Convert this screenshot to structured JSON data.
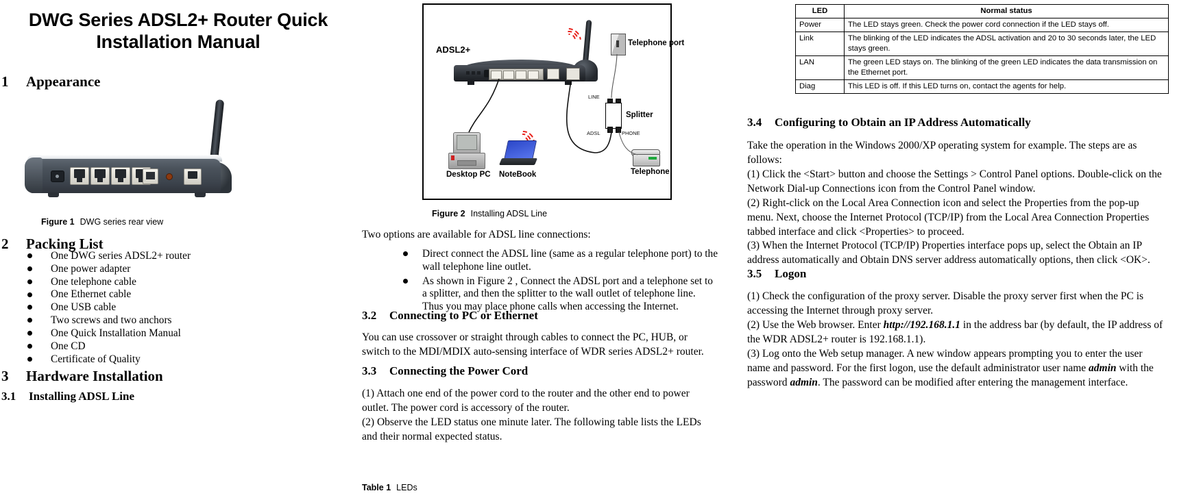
{
  "document": {
    "title": "DWG Series ADSL2+ Router Quick Installation Manual"
  },
  "left_column": {
    "section1": {
      "number": "1",
      "heading": "Appearance"
    },
    "figure1": {
      "label": "Figure 1",
      "caption": "DWG series rear view",
      "icon": "router-rear-view-photo"
    },
    "section2": {
      "number": "2",
      "heading": "Packing List"
    },
    "packing_list": [
      "One DWG  series ADSL2+ router",
      "One power adapter",
      "One telephone cable",
      "One Ethernet cable",
      "One USB cable",
      "Two screws and two anchors",
      "One Quick Installation Manual",
      "One CD",
      "Certificate of Quality"
    ],
    "section3": {
      "number": "3",
      "heading": "Hardware Installation"
    },
    "section3_1": {
      "number": "3.1",
      "heading": "Installing ADSL Line"
    }
  },
  "mid_column": {
    "figure2": {
      "label": "Figure 2",
      "caption": "Installing ADSL Line",
      "diagram_labels": {
        "adsl2plus": "ADSL2+",
        "desktop_pc": "Desktop PC",
        "notebook": "NoteBook",
        "telephone_port": "Telephone port",
        "splitter": "Splitter",
        "telephone": "Telephone",
        "line": "LINE",
        "adsl": "ADSL",
        "phone": "PHONE"
      }
    },
    "intro": "Two options are available for ADSL line connections:",
    "options": [
      "Direct connect the ADSL line (same as a regular telephone port) to the wall telephone line outlet.",
      "As shown in Figure 2 , Connect the ADSL port and a telephone set to a splitter, and then the splitter to the wall outlet of telephone line. Thus you may place phone calls when accessing the Internet."
    ],
    "section3_2": {
      "number": "3.2",
      "heading": "Connecting to PC or Ethernet",
      "body": "You can use crossover or straight through cables to connect the PC, HUB, or switch to the MDI/MDIX auto-sensing interface of WDR series ADSL2+ router."
    },
    "section3_3": {
      "number": "3.3",
      "heading": "Connecting the Power Cord",
      "para1": "(1) Attach one end of the power cord to the router and the other end to power outlet. The power cord is accessory of the router.",
      "para2": "(2) Observe the LED status one minute later. The following table lists the LEDs and their normal expected status."
    },
    "table1": {
      "label": "Table 1",
      "caption": "LEDs"
    }
  },
  "right_column": {
    "led_table": {
      "headers": [
        "LED",
        "Normal status"
      ],
      "rows": [
        [
          "Power",
          "The LED stays green. Check the power cord connection if the LED stays off."
        ],
        [
          "Link",
          "The blinking of the LED indicates the ADSL activation and 20 to 30 seconds later, the LED stays green."
        ],
        [
          "LAN",
          "The green LED stays on. The blinking of the green LED indicates the data transmission on the Ethernet port."
        ],
        [
          "Diag",
          "This LED is off. If this LED turns on, contact the agents for help."
        ]
      ]
    },
    "section3_4": {
      "number": "3.4",
      "heading": "Configuring to Obtain an IP Address Automatically",
      "para1": "Take the operation in the Windows 2000/XP operating system for example. The steps are as follows:",
      "para2": "(1) Click the <Start> button and choose the Settings > Control Panel options. Double-click on the Network Dial-up Connections icon from the Control Panel window.",
      "para3": "(2) Right-click on the Local Area Connection icon and select the Properties from the pop-up menu. Next, choose the Internet Protocol (TCP/IP) from the Local Area Connection Properties tabbed interface and click <Properties> to proceed.",
      "para4": "(3) When the Internet Protocol (TCP/IP) Properties interface pops up, select the Obtain an IP address automatically and Obtain DNS server address automatically options, then click <OK>."
    },
    "section3_5": {
      "number": "3.5",
      "heading": "Logon",
      "para1": "(1) Check the configuration of the proxy server. Disable the proxy server first when the PC is accessing the Internet through proxy server.",
      "para2_a": "(2) Use the Web browser. Enter ",
      "para2_url": "http://192.168.1.1",
      "para2_b": " in the address bar (by default, the IP address of the WDR ADSL2+ router is 192.168.1.1).",
      "para3_a": "(3) Log onto the Web setup manager. A new window appears prompting you to enter the user name and password. For the first logon, use the default administrator user name ",
      "para3_user": "admin",
      "para3_b": " with the password ",
      "para3_pass": "admin",
      "para3_c": ". The password can be modified after entering the management interface."
    }
  }
}
